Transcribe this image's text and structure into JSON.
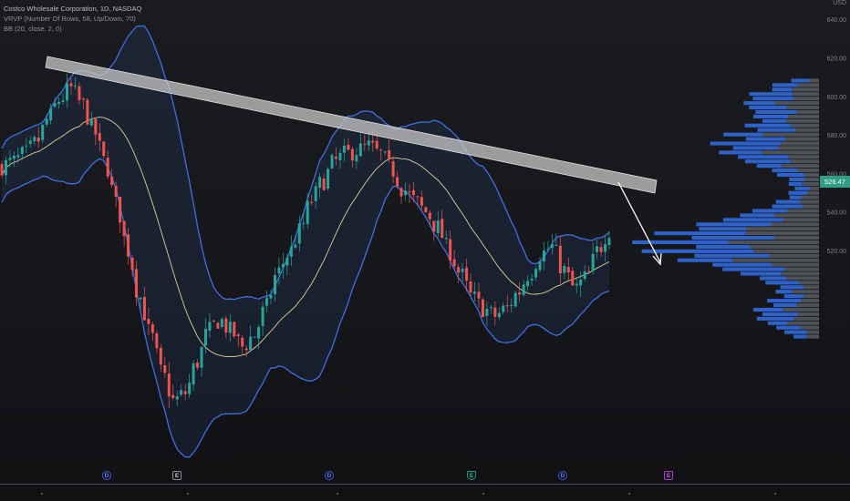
{
  "legend": {
    "title": "Costco Wholesale Corporation, 1D, NASDAQ",
    "vrvp": "VRVP (Number Of Rows, 58, Up/Down, 70)",
    "bb": "BB (20, close, 2, 0)"
  },
  "price_axis": {
    "current_price_label": "526.47",
    "current_price": 526.47,
    "ticks": [
      {
        "label": "USD",
        "value": 649
      },
      {
        "label": "640.00",
        "value": 640
      },
      {
        "label": "620.00",
        "value": 620
      },
      {
        "label": "600.00",
        "value": 600
      },
      {
        "label": "580.00",
        "value": 580
      },
      {
        "label": "560.00",
        "value": 560
      },
      {
        "label": "540.00",
        "value": 540
      },
      {
        "label": "520.00",
        "value": 520
      }
    ]
  },
  "colors": {
    "up": "#26a69a",
    "down": "#ef5350",
    "band": "#3e6fe0",
    "basis": "#d8d29c",
    "profile_up": "#2f62c9",
    "profile_down": "#5e6068",
    "trendline": "#d0d0d0",
    "arrow": "#ffffff"
  },
  "events": [
    {
      "kind": "dividend",
      "symbol": "D"
    },
    {
      "kind": "earnings",
      "symbol": "E"
    },
    {
      "kind": "dividend",
      "symbol": "D"
    },
    {
      "kind": "earnings",
      "symbol": "E"
    },
    {
      "kind": "dividend",
      "symbol": "D"
    },
    {
      "kind": "earnings",
      "symbol": "E"
    }
  ],
  "chart_data": {
    "type": "candlestick",
    "title": "Costco Wholesale Corporation, 1D, NASDAQ",
    "y_axis_unit": "USD",
    "ylim": [
      390,
      650
    ],
    "last_price": 526.47,
    "series": [
      {
        "name": "price_path_approx",
        "values": [
          564,
          566,
          570,
          576,
          588,
          598,
          604,
          596,
          582,
          566,
          544,
          520,
          496,
          476,
          456,
          442,
          446,
          462,
          478,
          484,
          478,
          470,
          476,
          490,
          508,
          518,
          530,
          546,
          556,
          566,
          570,
          572,
          574,
          570,
          562,
          552,
          546,
          540,
          532,
          520,
          508,
          496,
          490,
          486,
          490,
          498,
          508,
          518,
          522,
          510,
          500,
          506,
          520,
          531
        ]
      }
    ],
    "annotations": [
      "descending resistance channel",
      "projected move down arrow"
    ]
  }
}
